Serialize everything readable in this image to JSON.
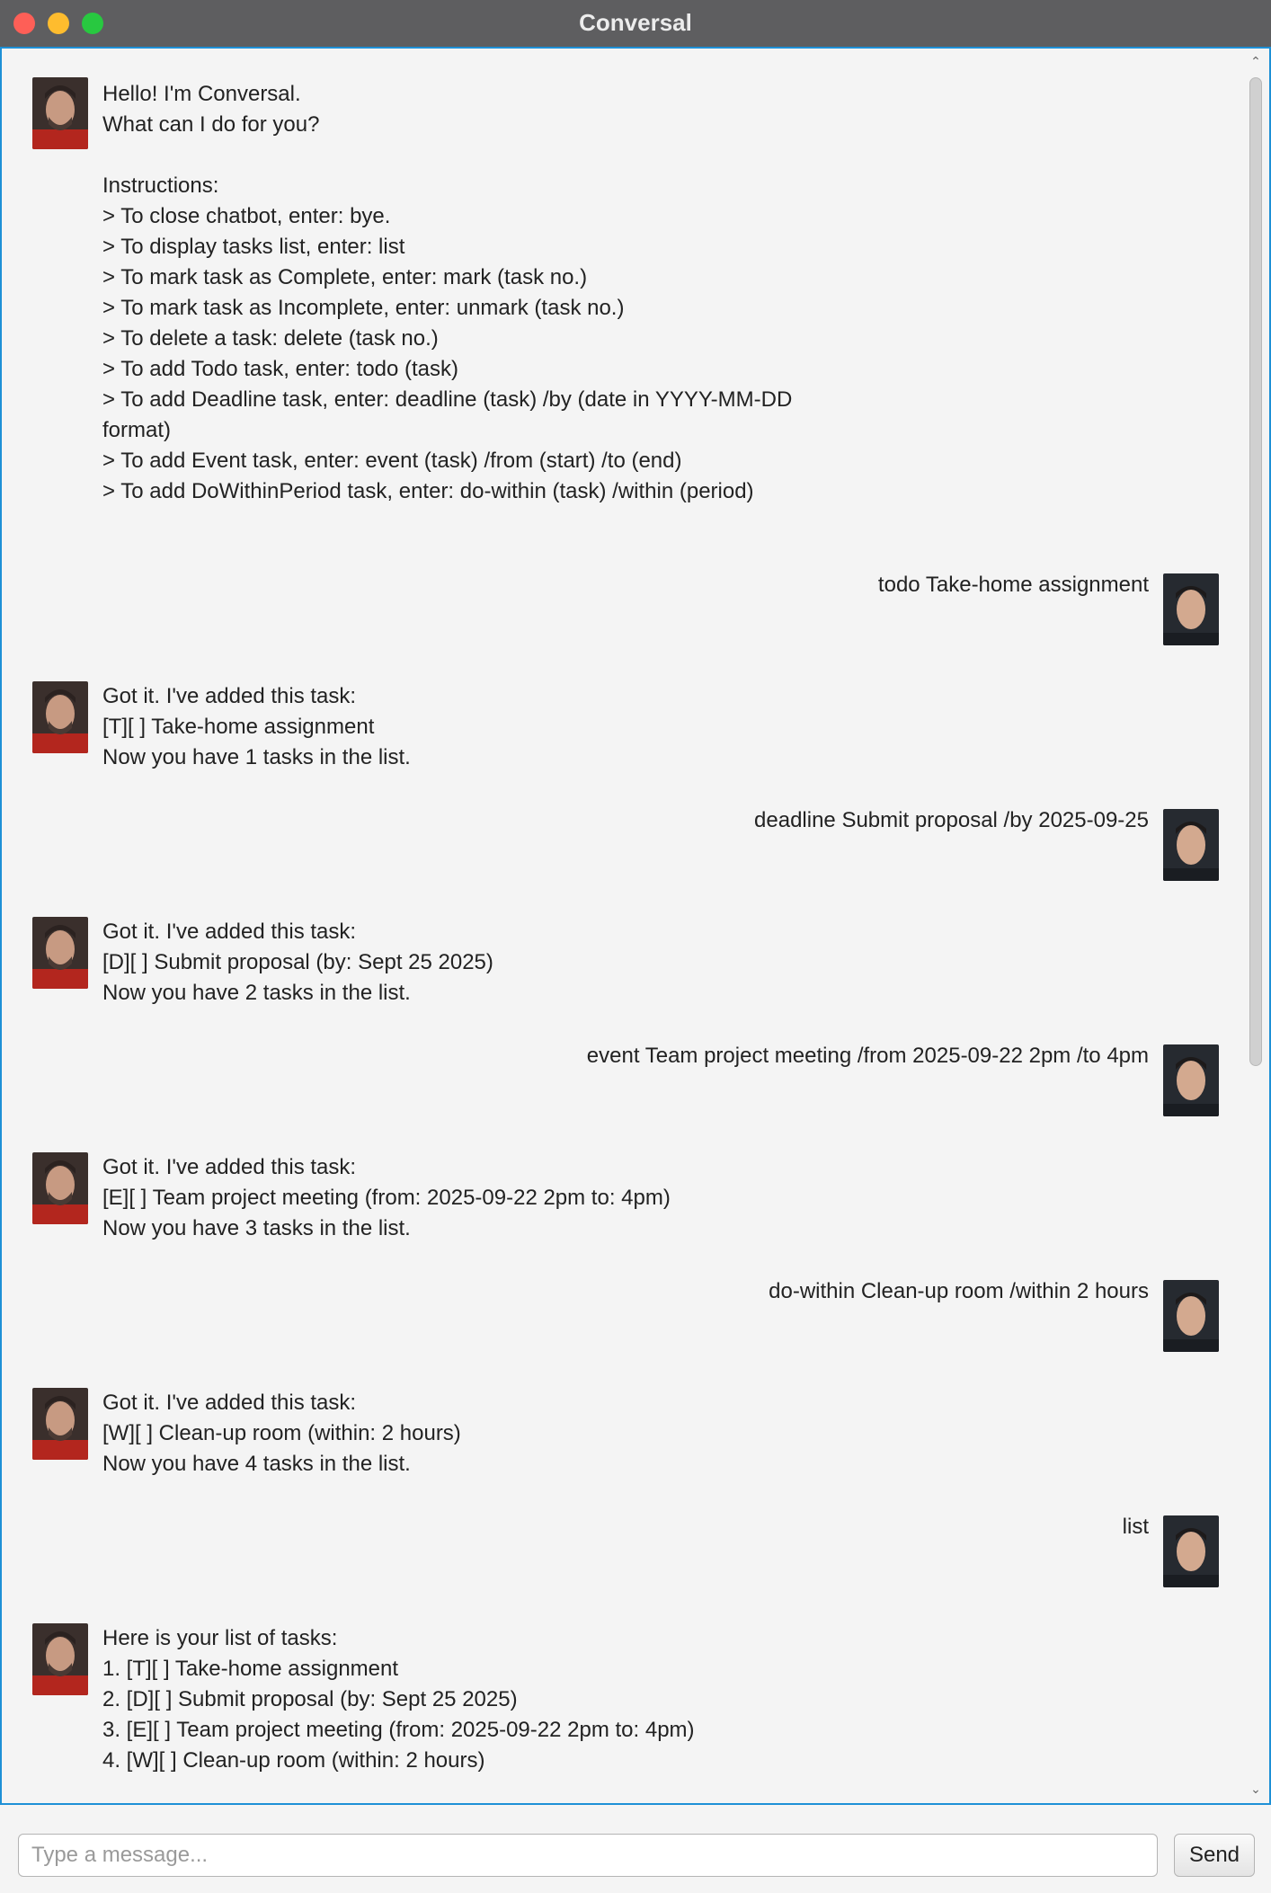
{
  "window": {
    "title": "Conversal"
  },
  "input": {
    "placeholder": "Type a message...",
    "value": ""
  },
  "send_label": "Send",
  "messages": [
    {
      "sender": "bot",
      "text": "Hello! I'm Conversal.\nWhat can I do for you?\n\nInstructions:\n> To close chatbot, enter: bye.\n> To display tasks list, enter: list\n> To mark task as Complete, enter: mark (task no.)\n> To mark task as Incomplete, enter: unmark (task no.)\n> To delete a task: delete (task no.)\n> To add Todo task, enter: todo (task)\n> To add Deadline task, enter: deadline (task) /by (date in YYYY-MM-DD\nformat)\n> To add Event task, enter: event (task) /from (start) /to (end)\n> To add DoWithinPeriod task, enter: do-within (task) /within (period)"
    },
    {
      "sender": "user",
      "text": "todo Take-home assignment"
    },
    {
      "sender": "bot",
      "text": "Got it. I've added this task:\n[T][ ] Take-home assignment\nNow you have 1 tasks in the list."
    },
    {
      "sender": "user",
      "text": "deadline Submit proposal /by 2025-09-25"
    },
    {
      "sender": "bot",
      "text": "Got it. I've added this task:\n[D][ ] Submit proposal (by: Sept 25 2025)\nNow you have 2 tasks in the list."
    },
    {
      "sender": "user",
      "text": "event Team project meeting /from 2025-09-22 2pm /to 4pm"
    },
    {
      "sender": "bot",
      "text": "Got it. I've added this task:\n[E][ ] Team project meeting (from: 2025-09-22 2pm to: 4pm)\nNow you have 3 tasks in the list."
    },
    {
      "sender": "user",
      "text": "do-within Clean-up room /within 2 hours"
    },
    {
      "sender": "bot",
      "text": "Got it. I've added this task:\n[W][ ] Clean-up room (within: 2 hours)\nNow you have 4 tasks in the list."
    },
    {
      "sender": "user",
      "text": "list"
    },
    {
      "sender": "bot",
      "text": "Here is your list of tasks:\n1. [T][ ] Take-home assignment\n2. [D][ ] Submit proposal (by: Sept 25 2025)\n3. [E][ ] Team project meeting (from: 2025-09-22 2pm to: 4pm)\n4. [W][ ] Clean-up room (within: 2 hours)"
    }
  ],
  "colors": {
    "accent": "#1e90d6",
    "titlebar": "#5e5e60",
    "background": "#f4f4f4"
  },
  "icons": {
    "bot_avatar": "bot-avatar-icon",
    "user_avatar": "user-avatar-icon"
  }
}
